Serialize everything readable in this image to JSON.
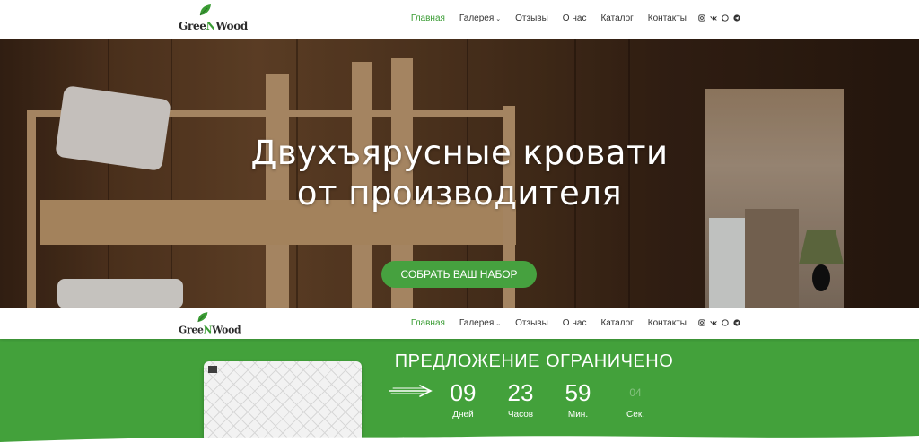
{
  "brand": {
    "logo_text_a": "Gree",
    "logo_text_b": "N",
    "logo_text_c": "Wood",
    "accent": "#3a9c34"
  },
  "nav": {
    "items": [
      {
        "label": "Главная",
        "active": true
      },
      {
        "label": "Галерея",
        "dropdown": true
      },
      {
        "label": "Отзывы"
      },
      {
        "label": "О нас"
      },
      {
        "label": "Каталог"
      },
      {
        "label": "Контакты"
      }
    ],
    "caret": "⌄",
    "socials": [
      "instagram-icon",
      "vk-icon",
      "whatsapp-icon",
      "telegram-icon"
    ]
  },
  "hero": {
    "title_line1": "Двухъярусные кровати",
    "title_line2": "от производителя",
    "cta": "СОБРАТЬ ВАШ НАБОР",
    "cta_color": "#46a13f"
  },
  "promo": {
    "title": "ПРЕДЛОЖЕНИЕ ОГРАНИЧЕНО",
    "bg": "#43a13b",
    "countdown": [
      {
        "value": "09",
        "label": "Дней"
      },
      {
        "value": "23",
        "label": "Часов"
      },
      {
        "value": "59",
        "label": "Мин."
      },
      {
        "value": "04",
        "label": "Сек."
      }
    ]
  }
}
